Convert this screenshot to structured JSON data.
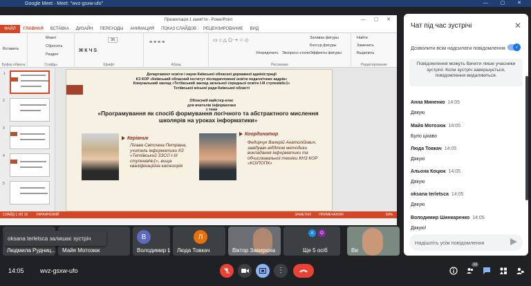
{
  "browser": {
    "tab_title": "Google Meet · Meet: \"wvz-gsxw-ufo\""
  },
  "powerpoint": {
    "window_title": "Презентація 1 заняття - PowerPoint",
    "tabs": [
      "ФАЙЛ",
      "ГЛАВНАЯ",
      "ВСТАВКА",
      "ДИЗАЙН",
      "ПЕРЕХОДЫ",
      "АНИМАЦИЯ",
      "ПОКАЗ СЛАЙДОВ",
      "РЕЦЕНЗИРОВАНИЕ",
      "ВИД"
    ],
    "active_tab": "ГЛАВНАЯ",
    "ribbon": {
      "paste": "Вставить",
      "layout": "Макет",
      "reset": "Сбросить",
      "section": "Раздел",
      "font_size": "36",
      "arrange": "Упорядочить",
      "quick_styles": "Экспресс-стили",
      "shape_fill": "Заливка фигуры",
      "shape_outline": "Контур фигуры",
      "shape_effects": "Эффекты фигуры",
      "find": "Найти",
      "replace": "Заменить",
      "select": "Выделить",
      "groups": [
        "Буфер обмена",
        "Слайды",
        "Шрифт",
        "Абзац",
        "Рисование",
        "Редактирование"
      ]
    },
    "slide": {
      "header_lines": [
        "Департамент освіти і науки Київської обласної державної адміністрації",
        "КЗ КОР «Київський обласний інститут післядипломної освіти педагогічних кадрів»",
        "Комунальний заклад «Тетіївський заклад загальної середньої освіти І-ІІІ ступенів№1»",
        "Тетіївської міської ради Київської області"
      ],
      "sub_lines": [
        "Обласний майстер-клас",
        "для вчителів інформатики",
        "з теми"
      ],
      "theme": "«Програмування як спосіб формування логічного та абстрактного мислення школярів на уроках інформатики»",
      "leader_role": "Керівник",
      "leader_text": "Лігава Світлана Петрівна, учитель інформатики КЗ «Тетіївський ЗЗСО І-ІІІ ступенів№1», вища кваліфікаційна категорія",
      "coordinator_role": "Координатор",
      "coordinator_text": "Федорчук Валерій Анатолійович, завідувач відділом методики викладання інформатики та обчислювальної техніки КНЗ КОР «КОІПОПК»"
    },
    "status": {
      "slide_info": "СЛАЙД 1 ИЗ 19",
      "language": "УКРАИНСКИЙ",
      "notes": "ЗАМЕТКИ",
      "comments": "ПРИМЕЧАНИЯ",
      "zoom": "60%"
    }
  },
  "toast": "oksana terletsca залишає зустріч",
  "participants": [
    {
      "name": "Людмила Рудниц...",
      "initial": ""
    },
    {
      "name": "Майя Мотозюк",
      "initial": ""
    },
    {
      "name": "Володимир Шинк...",
      "initial": "В"
    },
    {
      "name": "Люда Товкач",
      "initial": "Л"
    },
    {
      "name": "Віктор Завирюха",
      "initial": ""
    },
    {
      "name": "Ще 5 осіб",
      "initial": ""
    },
    {
      "name": "Ви",
      "initial": ""
    }
  ],
  "bottombar": {
    "time": "14:05",
    "meeting_code": "wvz-gsxw-ufo",
    "people_count": "12"
  },
  "chat": {
    "title": "Чат під час зустрічі",
    "allow_label": "Дозволити всім надсилати повідомлення",
    "info": "Повідомлення можуть бачити лише учасники зустрічі. Коли зустріч завершується, повідомлення видаляються.",
    "messages": [
      {
        "sender": "Анна Миненко",
        "time": "14:05",
        "text": "Дякую"
      },
      {
        "sender": "Майя Мотозюк",
        "time": "14:05",
        "text": "Було цікаво"
      },
      {
        "sender": "Люда Товкач",
        "time": "14:05",
        "text": "Дякую"
      },
      {
        "sender": "Альона Коцюк",
        "time": "14:05",
        "text": "Дякую"
      },
      {
        "sender": "oksana terletsca",
        "time": "14:05",
        "text": "Дякую"
      },
      {
        "sender": "Володимир Шинкаренко",
        "time": "14:05",
        "text": "Дякую!"
      }
    ],
    "input_placeholder": "Надішліть усім повідомлення"
  },
  "colors": {
    "accent": "#1a73e8",
    "ppt_orange": "#d24726",
    "end_call": "#ea4335"
  }
}
